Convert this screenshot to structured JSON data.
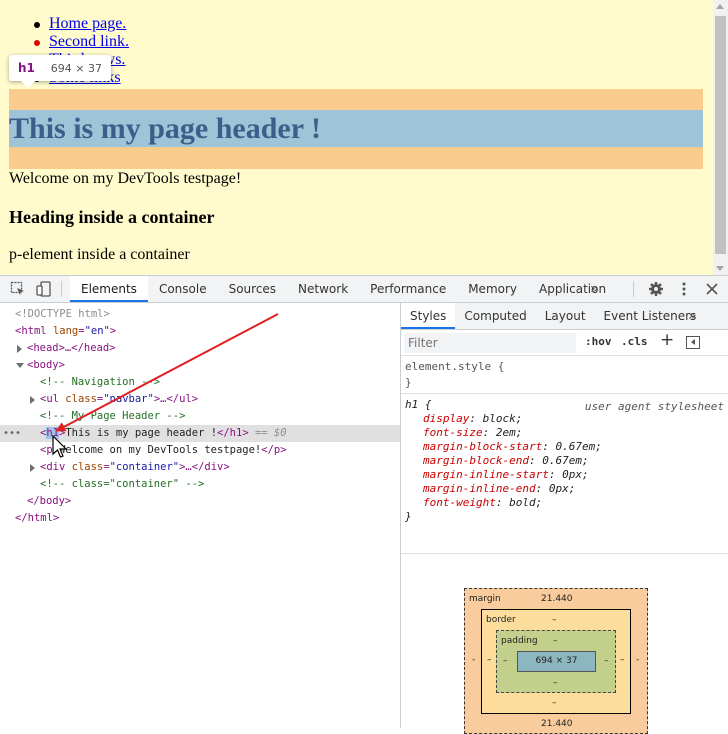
{
  "page": {
    "nav_links": [
      {
        "label": "Home page.",
        "bullet": "#000000"
      },
      {
        "label": "Second link.",
        "bullet": "#e00000"
      },
      {
        "label": "Third news.",
        "bullet": "#000000"
      },
      {
        "label": "Some links",
        "bullet": "#000000"
      }
    ],
    "header": "This is my page header !",
    "welcome": "Welcome on my DevTools testpage!",
    "container_heading": "Heading inside a container",
    "container_paragraph": "p-element inside a container"
  },
  "tooltip": {
    "tag": "h1",
    "size": "694 × 37"
  },
  "devtools": {
    "tabs": [
      "Elements",
      "Console",
      "Sources",
      "Network",
      "Performance",
      "Memory",
      "Application"
    ],
    "active_tab": "Elements",
    "more_tabs": "»",
    "icons": [
      "inspect-icon",
      "device-toolbar-icon",
      "settings-icon",
      "kebab-menu-icon",
      "close-icon"
    ]
  },
  "elements_tree": {
    "doctype": "<!DOCTYPE html>",
    "html_open": "<html",
    "html_attr": "lang",
    "html_val": "\"en\"",
    "head": "<head>…</head>",
    "body_open": "<body>",
    "comment_nav": "<!-- Navigation -->",
    "ul_open": "<ul",
    "ul_attr": "class",
    "ul_val": "\"navbar\"",
    "ul_close": ">…</ul>",
    "comment_header": "<!-- My Page Header -->",
    "h1_lt": "<",
    "h1_tag": "h1",
    "h1_gt": ">",
    "h1_text": "This is my page header !",
    "h1_close": "</h1>",
    "h1_eq": " == $0",
    "p_open": "<p>",
    "p_text": "Welcome on my DevTools testpage!",
    "p_close": "</p>",
    "div_open": "<div",
    "div_attr": "class",
    "div_val": "\"container\"",
    "div_close": ">…</div>",
    "comment_container": "<!-- class=\"container\" -->",
    "body_close": "</body>",
    "html_close": "</html>",
    "dots": "•••"
  },
  "styles": {
    "sub_tabs": [
      "Styles",
      "Computed",
      "Layout",
      "Event Listeners"
    ],
    "active_sub_tab": "Styles",
    "more": "»",
    "filter_placeholder": "Filter",
    "hov": ":hov",
    "cls": ".cls",
    "plus": "+",
    "element_style_open": "element.style {",
    "element_style_close": "}",
    "rule_selector": "h1 {",
    "rule_source": "user agent stylesheet",
    "rule_close": "}",
    "properties": [
      {
        "name": "display",
        "value": "block;"
      },
      {
        "name": "font-size",
        "value": "2em;"
      },
      {
        "name": "margin-block-start",
        "value": "0.67em;"
      },
      {
        "name": "margin-block-end",
        "value": "0.67em;"
      },
      {
        "name": "margin-inline-start",
        "value": "0px;"
      },
      {
        "name": "margin-inline-end",
        "value": "0px;"
      },
      {
        "name": "font-weight",
        "value": "bold;"
      }
    ]
  },
  "box_model": {
    "margin_label": "margin",
    "margin_top": "21.440",
    "margin_bottom": "21.440",
    "margin_left": "-",
    "margin_right": "-",
    "border_label": "border",
    "border_top": "–",
    "border_bottom": "–",
    "border_left": "–",
    "border_right": "–",
    "padding_label": "padding",
    "padding_top": "–",
    "padding_bottom": "–",
    "padding_left": "–",
    "padding_right": "–",
    "content": "694 × 37"
  }
}
